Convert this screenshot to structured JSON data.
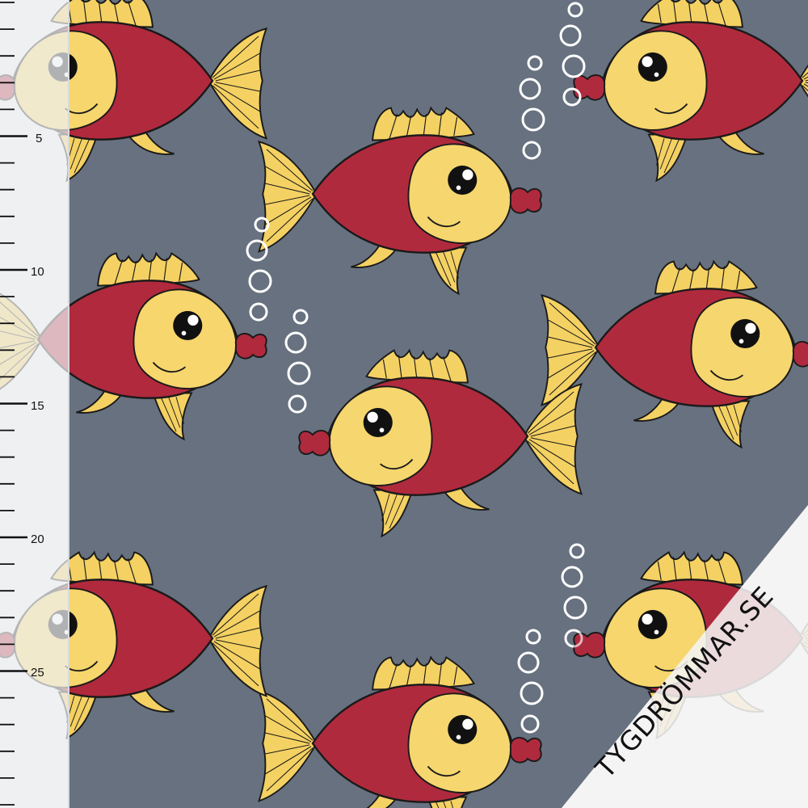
{
  "ruler": {
    "unit_labels": [
      "5",
      "10",
      "15",
      "20",
      "25"
    ],
    "labeled_values": [
      5,
      10,
      15,
      20,
      25
    ],
    "max_value": 30
  },
  "watermark": {
    "text": "TYGDRÖMMAR.SE"
  },
  "colors": {
    "fabric_background": "#67717f",
    "fish_body": "#b02a3e",
    "fish_face": "#f6d66e",
    "fin": "#f4d163",
    "outline": "#1a1a1a",
    "bubble": "#ffffff",
    "ruler_background": "#eff0f2"
  },
  "icons": {
    "fish": "fish-icon",
    "bubble": "bubble-icon"
  }
}
